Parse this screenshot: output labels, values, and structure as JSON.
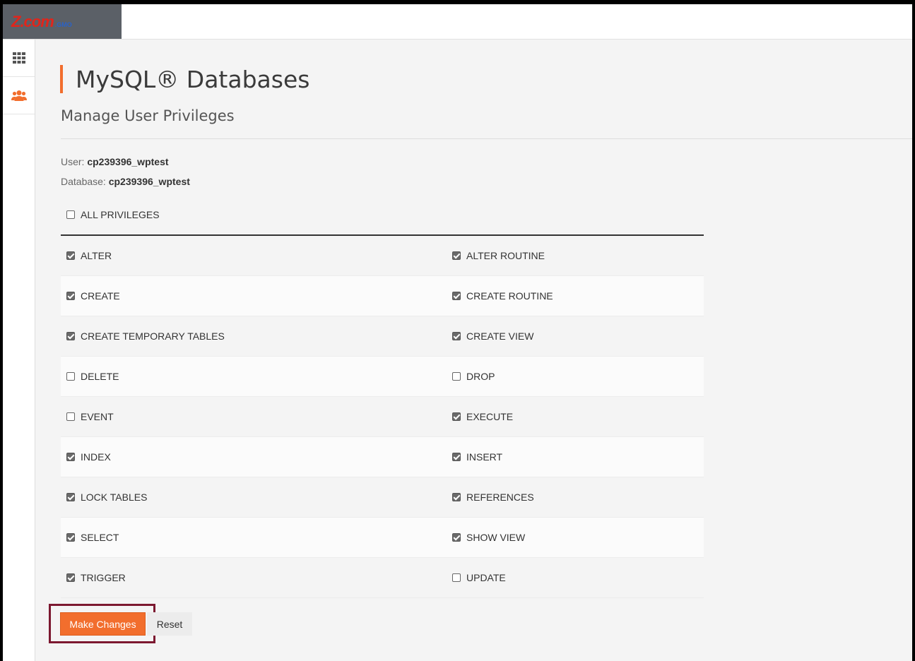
{
  "brand": {
    "logo_main": "Z.com",
    "logo_sub": ".GMO"
  },
  "sidebar": {
    "items": [
      {
        "icon": "grid-icon"
      },
      {
        "icon": "users-icon"
      }
    ]
  },
  "header": {
    "title": "MySQL® Databases",
    "subtitle": "Manage User Privileges"
  },
  "meta": {
    "user_label": "User:",
    "user_value": "cp239396_wptest",
    "database_label": "Database:",
    "database_value": "cp239396_wptest"
  },
  "all_privileges": {
    "label": "ALL PRIVILEGES",
    "checked": false
  },
  "privileges": [
    [
      {
        "label": "ALTER",
        "checked": true
      },
      {
        "label": "ALTER ROUTINE",
        "checked": true
      }
    ],
    [
      {
        "label": "CREATE",
        "checked": true
      },
      {
        "label": "CREATE ROUTINE",
        "checked": true
      }
    ],
    [
      {
        "label": "CREATE TEMPORARY TABLES",
        "checked": true
      },
      {
        "label": "CREATE VIEW",
        "checked": true
      }
    ],
    [
      {
        "label": "DELETE",
        "checked": false
      },
      {
        "label": "DROP",
        "checked": false
      }
    ],
    [
      {
        "label": "EVENT",
        "checked": false
      },
      {
        "label": "EXECUTE",
        "checked": true
      }
    ],
    [
      {
        "label": "INDEX",
        "checked": true
      },
      {
        "label": "INSERT",
        "checked": true
      }
    ],
    [
      {
        "label": "LOCK TABLES",
        "checked": true
      },
      {
        "label": "REFERENCES",
        "checked": true
      }
    ],
    [
      {
        "label": "SELECT",
        "checked": true
      },
      {
        "label": "SHOW VIEW",
        "checked": true
      }
    ],
    [
      {
        "label": "TRIGGER",
        "checked": true
      },
      {
        "label": "UPDATE",
        "checked": false
      }
    ]
  ],
  "actions": {
    "make_changes_label": "Make Changes",
    "reset_label": "Reset"
  },
  "colors": {
    "accent": "#f26e2d",
    "highlight_border": "#7c1830",
    "sidebar_icon": "#f26e2d"
  }
}
